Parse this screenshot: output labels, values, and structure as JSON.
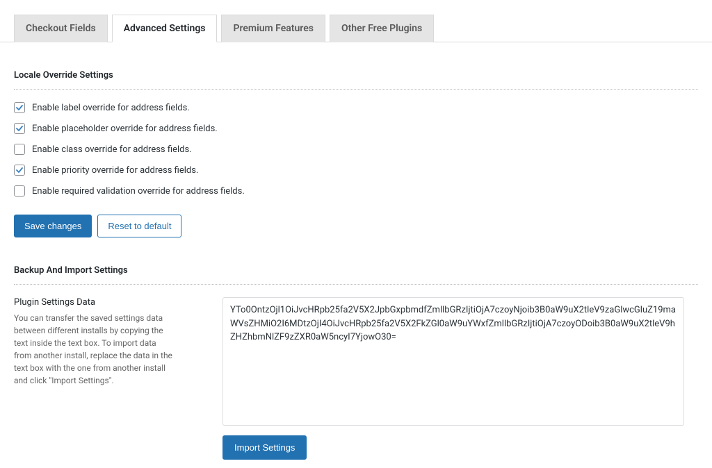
{
  "tabs": {
    "checkout_fields": "Checkout Fields",
    "advanced_settings": "Advanced Settings",
    "premium_features": "Premium Features",
    "other_free_plugins": "Other Free Plugins"
  },
  "locale": {
    "heading": "Locale Override Settings",
    "items": [
      {
        "label": "Enable label override for address fields.",
        "checked": true
      },
      {
        "label": "Enable placeholder override for address fields.",
        "checked": true
      },
      {
        "label": "Enable class override for address fields.",
        "checked": false
      },
      {
        "label": "Enable priority override for address fields.",
        "checked": true
      },
      {
        "label": "Enable required validation override for address fields.",
        "checked": false
      }
    ]
  },
  "buttons": {
    "save": "Save changes",
    "reset": "Reset to default",
    "import": "Import Settings"
  },
  "backup": {
    "heading": "Backup And Import Settings",
    "subheading": "Plugin Settings Data",
    "help": "You can transfer the saved settings data between different installs by copying the text inside the text box. To import data from another install, replace the data in the text box with the one from another install and click \"Import Settings\".",
    "data": "YTo0OntzOjl1OiJvcHRpb25fa2V5X2JpbGxpbmdfZmllbGRzIjtiOjA7czoyNjoib3B0aW9uX2tleV9zaGlwcGluZ19maWVsZHMiO2I6MDtzOjI4OiJvcHRpb25fa2V5X2FkZGl0aW9uYWxfZmllbGRzIjtiOjA7czoyODoib3B0aW9uX2tleV9hZHZhbmNlZF9zZXR0aW5ncyI7YjowO30="
  }
}
